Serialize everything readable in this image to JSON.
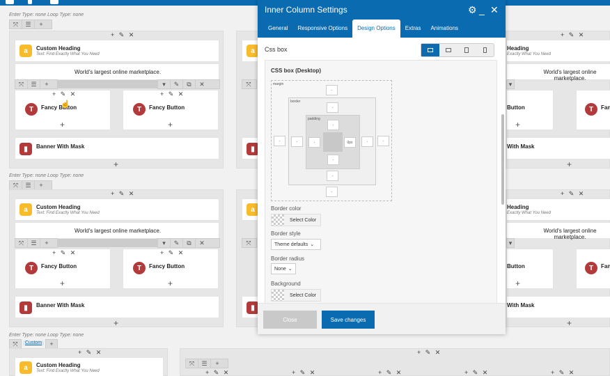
{
  "modal": {
    "title": "Inner Column Settings",
    "tabs": [
      {
        "label": "General",
        "active": false
      },
      {
        "label": "Responsive Options",
        "active": false
      },
      {
        "label": "Design Options",
        "active": true
      },
      {
        "label": "Extras",
        "active": false
      },
      {
        "label": "Animations",
        "active": false
      }
    ],
    "section_title": "Css box",
    "panel_title": "CSS box (Desktop)",
    "box_labels": {
      "margin": "margin",
      "border": "border",
      "padding": "padding"
    },
    "padding_right_value": "0px",
    "empty_value": "-",
    "fields": {
      "border_color_label": "Border color",
      "border_color_button": "Select Color",
      "border_style_label": "Border style",
      "border_style_value": "Theme defaults",
      "border_radius_label": "Border radius",
      "border_radius_value": "None",
      "background_label": "Background",
      "background_button": "Select Color"
    },
    "close_label": "Close",
    "save_label": "Save changes"
  },
  "builder": {
    "row_meta": "Enter Type: none  Loop Type: none",
    "custom_tag": "Custom",
    "heading_title": "Custom Heading",
    "heading_sub": "Text: Find Exactly What You Need",
    "marketplace_text": "World's largest online marketplace.",
    "fancy_button": "Fancy Button",
    "banner": "Banner With Mask",
    "partial_heading": "Heading",
    "partial_sub": "Exactly What You Need",
    "partial_button": "Button",
    "partial_fancy": "Fanc",
    "partial_banner": "With Mask",
    "plus": "+",
    "tools": "+ ✎ ✕"
  },
  "colors": {
    "accent": "#0a6bb0",
    "heading_icon": "#f8bb2b",
    "button_icon": "#b33a3a"
  }
}
